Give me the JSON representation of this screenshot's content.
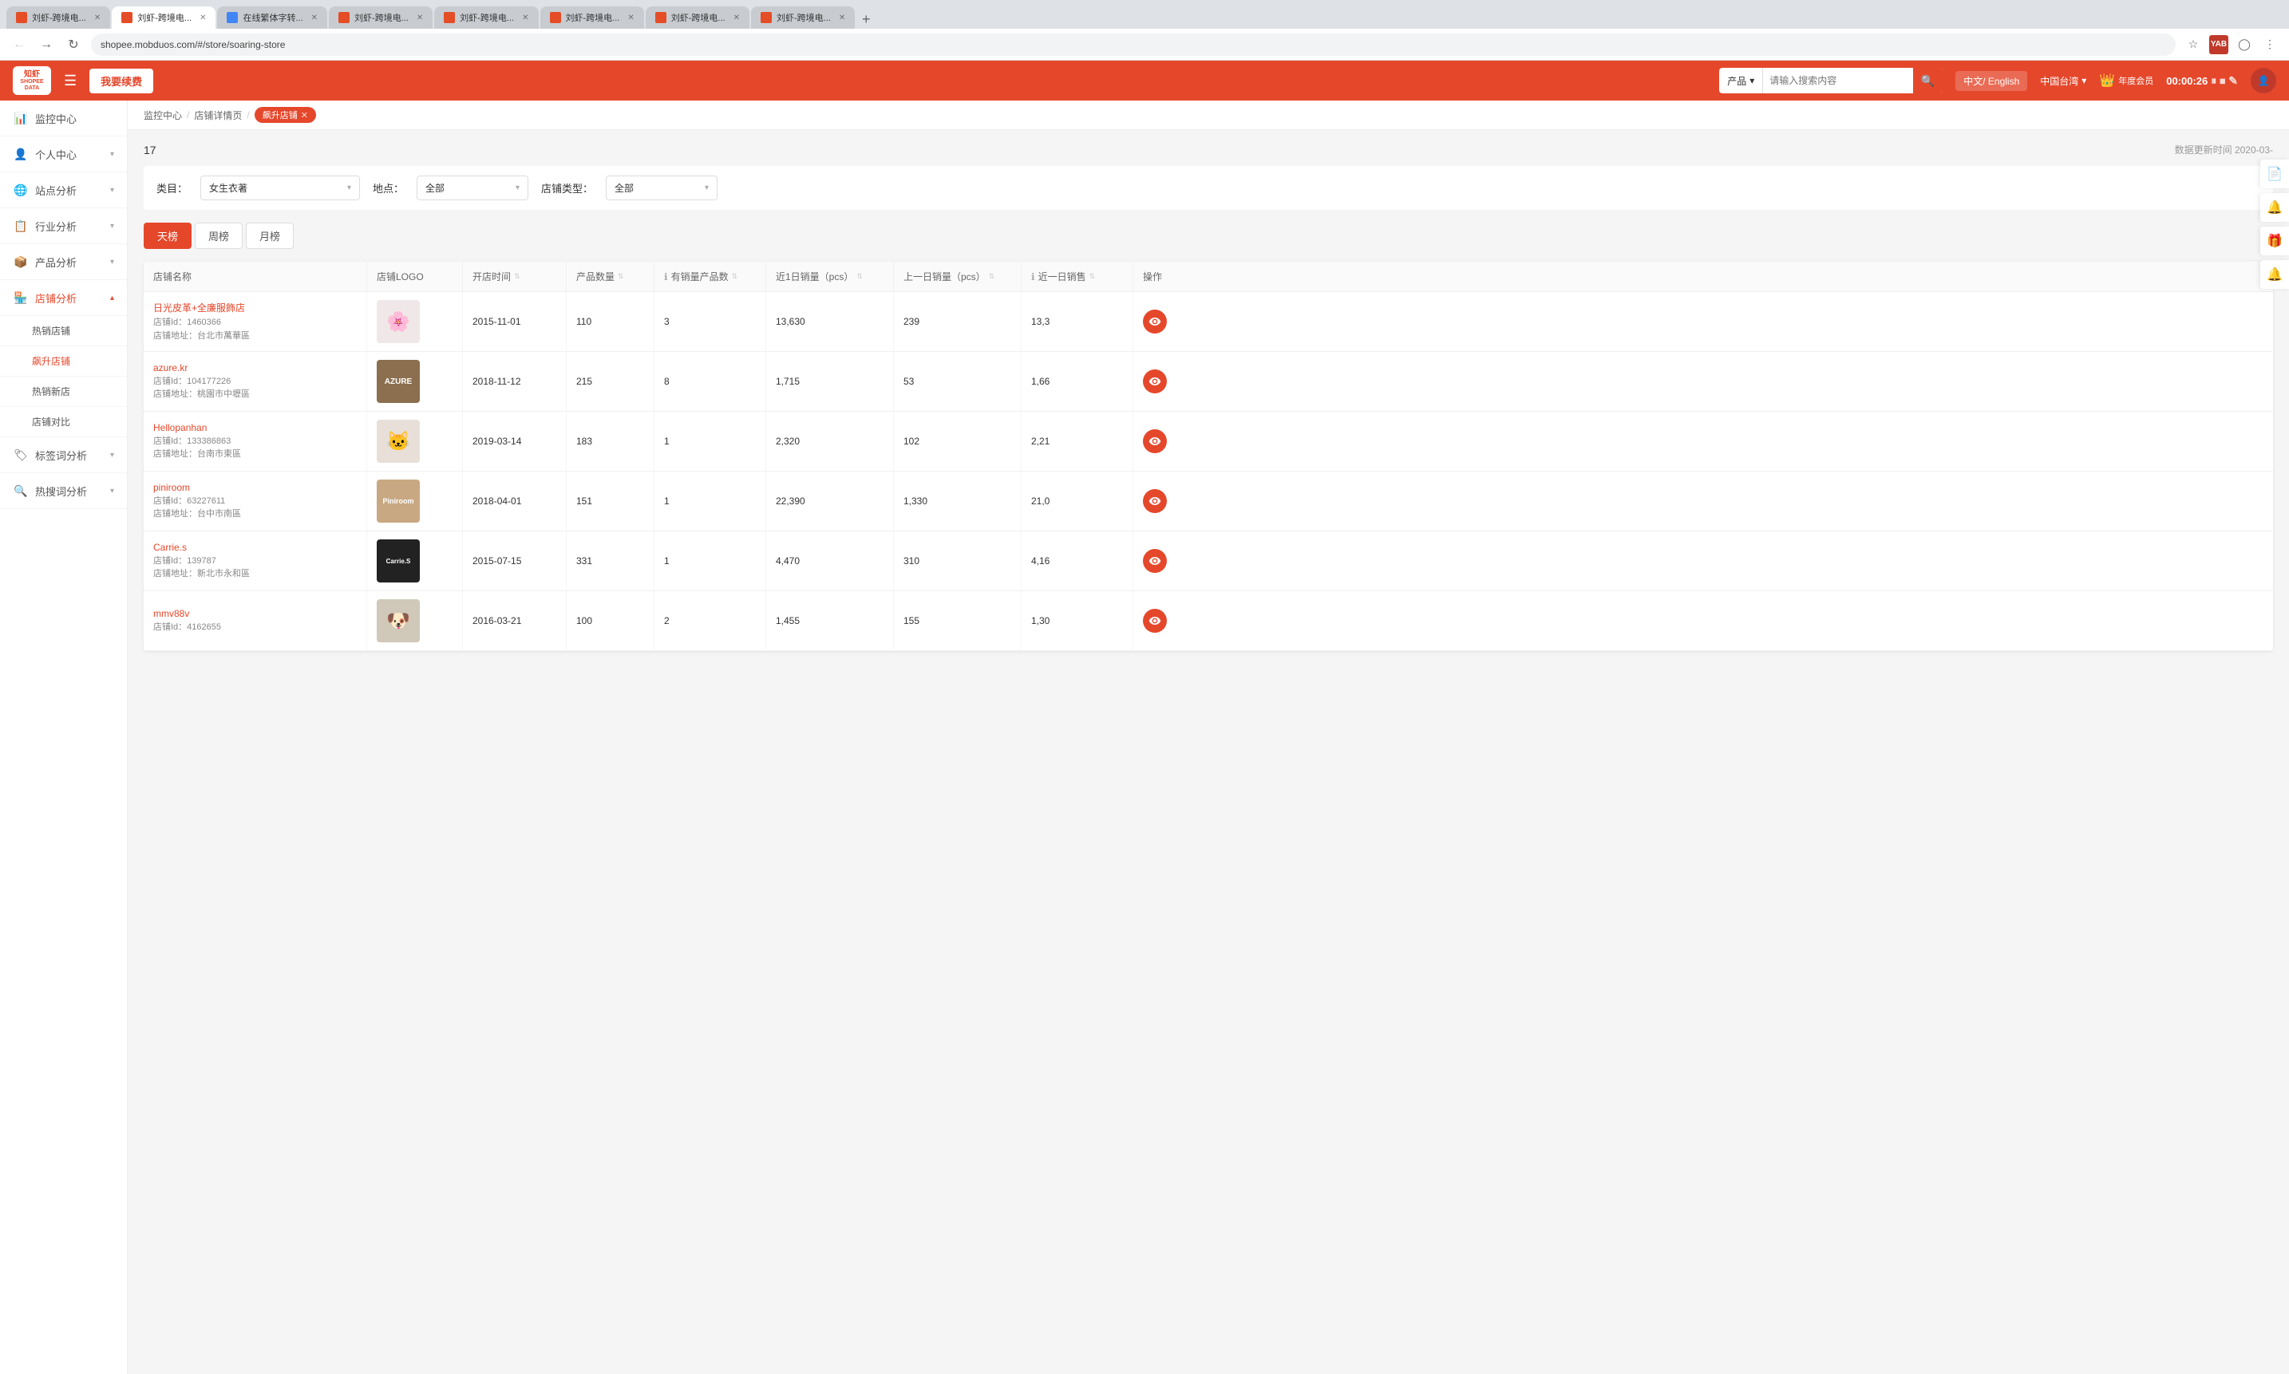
{
  "browser": {
    "url": "shopee.mobduos.com/#/store/soaring-store",
    "tabs": [
      {
        "label": "刘虾-跨境电...",
        "active": false
      },
      {
        "label": "刘虾-跨境电...",
        "active": true
      },
      {
        "label": "在线繁体字转...",
        "active": false
      },
      {
        "label": "刘虾-跨境电...",
        "active": false
      },
      {
        "label": "刘虾-跨境电...",
        "active": false
      },
      {
        "label": "刘虾-跨境电...",
        "active": false
      },
      {
        "label": "刘虾-跨境电...",
        "active": false
      },
      {
        "label": "刘虾-跨境电...",
        "active": false
      }
    ]
  },
  "topbar": {
    "logo_line1": "知虾",
    "logo_line2": "SHOPEE DATA",
    "upgrade_btn": "我要续费",
    "search_category": "产品",
    "search_placeholder": "请输入搜索内容",
    "language": "中文/ English",
    "region": "中国台湾",
    "vip_text": "年度会员",
    "timer": "00:00:26"
  },
  "sidebar": {
    "items": [
      {
        "label": "监控中心",
        "icon": "📊",
        "has_arrow": false,
        "active": false
      },
      {
        "label": "个人中心",
        "icon": "👤",
        "has_arrow": true,
        "active": false
      },
      {
        "label": "站点分析",
        "icon": "🌐",
        "has_arrow": true,
        "active": false
      },
      {
        "label": "行业分析",
        "icon": "📋",
        "has_arrow": true,
        "active": false
      },
      {
        "label": "产品分析",
        "icon": "📦",
        "has_arrow": true,
        "active": false
      },
      {
        "label": "店铺分析",
        "icon": "🏪",
        "has_arrow": true,
        "active": true
      },
      {
        "label": "热销店铺",
        "sub": true,
        "active": false
      },
      {
        "label": "飙升店铺",
        "sub": true,
        "active": true
      },
      {
        "label": "热销新店",
        "sub": true,
        "active": false
      },
      {
        "label": "店铺对比",
        "sub": true,
        "active": false
      },
      {
        "label": "标签词分析",
        "icon": "🏷",
        "has_arrow": true,
        "active": false
      },
      {
        "label": "热搜词分析",
        "icon": "🔍",
        "has_arrow": true,
        "active": false
      }
    ]
  },
  "breadcrumb": {
    "items": [
      "监控中心",
      "店铺详情页"
    ],
    "active_tag": "飙升店铺"
  },
  "content": {
    "record_count": "17",
    "data_update": "数据更新时间 2020-03-",
    "filter": {
      "category_label": "类目：",
      "category_value": "女生衣著",
      "location_label": "地点：",
      "location_value": "全部",
      "store_type_label": "店铺类型：",
      "store_type_value": "全部"
    },
    "tabs": [
      "天榜",
      "周榜",
      "月榜"
    ],
    "active_tab": 0,
    "table": {
      "headers": [
        "店铺名称",
        "店铺LOGO",
        "开店时间",
        "产品数量",
        "有销量产品数",
        "近1日销量（pcs）",
        "上一日销量（pcs）",
        "近一日销售",
        "操作"
      ],
      "rows": [
        {
          "name": "日光皮革+全廉服飾店",
          "id": "店铺Id：1460366",
          "address": "店铺地址：台北市萬華區",
          "logo_type": "flower",
          "open_date": "2015-11-01",
          "product_count": "110",
          "sales_product": "3",
          "daily_sales": "13,630",
          "prev_daily": "239",
          "recent_sales": "13,3"
        },
        {
          "name": "azure.kr",
          "id": "店铺Id：104177226",
          "address": "店铺地址：桃園市中壢區",
          "logo_type": "azure",
          "open_date": "2018-11-12",
          "product_count": "215",
          "sales_product": "8",
          "daily_sales": "1,715",
          "prev_daily": "53",
          "recent_sales": "1,66"
        },
        {
          "name": "Hellopanhan",
          "id": "店铺Id：133386863",
          "address": "店铺地址：台南市東區",
          "logo_type": "cat",
          "open_date": "2019-03-14",
          "product_count": "183",
          "sales_product": "1",
          "daily_sales": "2,320",
          "prev_daily": "102",
          "recent_sales": "2,21"
        },
        {
          "name": "piniroom",
          "id": "店铺Id：63227611",
          "address": "店铺地址：台中市南區",
          "logo_type": "piniroom",
          "open_date": "2018-04-01",
          "product_count": "151",
          "sales_product": "1",
          "daily_sales": "22,390",
          "prev_daily": "1,330",
          "recent_sales": "21,0"
        },
        {
          "name": "Carrie.s",
          "id": "店铺Id：139787",
          "address": "店铺地址：新北市永和區",
          "logo_type": "carries",
          "open_date": "2015-07-15",
          "product_count": "331",
          "sales_product": "1",
          "daily_sales": "4,470",
          "prev_daily": "310",
          "recent_sales": "4,16"
        },
        {
          "name": "mmv88v",
          "id": "店铺Id：4162655",
          "address": "",
          "logo_type": "mmv",
          "open_date": "2016-03-21",
          "product_count": "100",
          "sales_product": "2",
          "daily_sales": "1,455",
          "prev_daily": "155",
          "recent_sales": "1,30"
        }
      ]
    }
  },
  "right_sidebar": {
    "icons": [
      "📄",
      "🔔",
      "🎁",
      "🔔"
    ]
  }
}
